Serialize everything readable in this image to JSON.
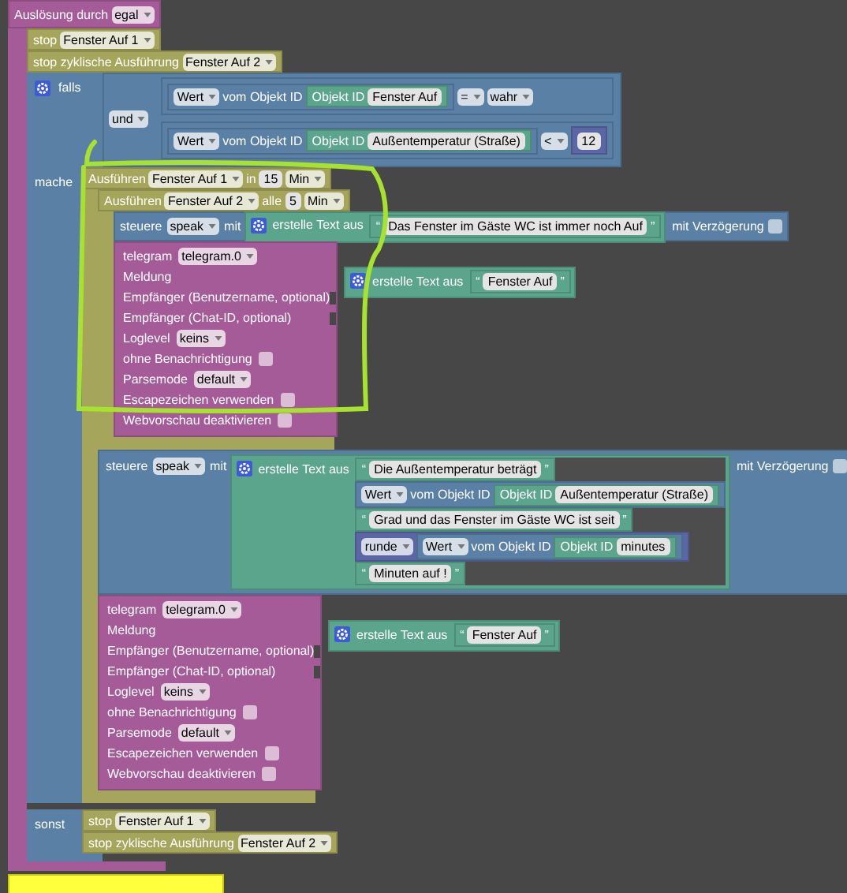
{
  "trigger": {
    "label": "Auslösung durch",
    "value": "egal"
  },
  "top_actions": [
    {
      "label": "stop",
      "value": "Fenster Auf 1"
    },
    {
      "label": "stop zyklische Ausführung",
      "value": "Fenster Auf 2"
    }
  ],
  "if_block": {
    "if_label": "falls",
    "do_label": "mache",
    "else_label": "sonst",
    "logic": "und",
    "conditions": [
      {
        "source": "Wert",
        "of": "vom Objekt ID",
        "id_label": "Objekt ID",
        "object": "Fenster Auf",
        "operator": "=",
        "kind": "bool",
        "value": "wahr"
      },
      {
        "source": "Wert",
        "of": "vom Objekt ID",
        "id_label": "Objekt ID",
        "object": "Außentemperatur (Straße)",
        "operator": "<",
        "kind": "number",
        "value": "12"
      }
    ]
  },
  "timer_1": {
    "label": "Ausführen",
    "value": "Fenster Auf 1",
    "in": "in",
    "amount": "15",
    "unit": "Min"
  },
  "timer_2": {
    "label": "Ausführen",
    "value": "Fenster Auf 2",
    "in": "alle",
    "amount": "5",
    "unit": "Min"
  },
  "speak_1": {
    "label": "steuere",
    "target": "speak",
    "with": "mit",
    "join": {
      "label": "erstelle Text aus",
      "parts": [
        {
          "kind": "text",
          "open": "“",
          "text": "Das Fenster im Gäste WC ist immer noch Auf",
          "close": "”"
        }
      ]
    },
    "delay_label": "mit Verzögerung",
    "delay": false
  },
  "telegram_1": {
    "label": "telegram",
    "instance": "telegram.0",
    "message_label": "Meldung",
    "message": {
      "label": "erstelle Text aus",
      "parts": [
        {
          "kind": "text",
          "open": "“",
          "text": "Fenster Auf",
          "close": "”"
        }
      ]
    },
    "rows": [
      {
        "kind": "input",
        "label": "Empfänger (Benutzername, optional)"
      },
      {
        "kind": "input",
        "label": "Empfänger (Chat-ID, optional)"
      },
      {
        "kind": "dropdown",
        "label": "Loglevel",
        "value": "keins"
      },
      {
        "kind": "checkbox",
        "label": "ohne Benachrichtigung",
        "checked": false
      },
      {
        "kind": "dropdown",
        "label": "Parsemode",
        "value": "default"
      },
      {
        "kind": "checkbox",
        "label": "Escapezeichen verwenden",
        "checked": false
      },
      {
        "kind": "checkbox",
        "label": "Webvorschau deaktivieren",
        "checked": false
      }
    ]
  },
  "speak_2": {
    "label": "steuere",
    "target": "speak",
    "with": "mit",
    "join": {
      "label": "erstelle Text aus",
      "parts": [
        {
          "kind": "text",
          "open": "“",
          "text": "Die Außentemperatur beträgt",
          "close": "”"
        },
        {
          "kind": "value",
          "source": "Wert",
          "of": "vom Objekt ID",
          "id_label": "Objekt ID",
          "object": "Außentemperatur (Straße)"
        },
        {
          "kind": "text",
          "open": "“",
          "text": "Grad und das Fenster im Gäste WC ist seit",
          "close": "”"
        },
        {
          "kind": "round",
          "op": "runde",
          "source": "Wert",
          "of": "vom Objekt ID",
          "id_label": "Objekt ID",
          "object": "minutes"
        },
        {
          "kind": "text",
          "open": "“",
          "text": "Minuten auf !",
          "close": "”"
        }
      ]
    },
    "delay_label": "mit Verzögerung",
    "delay": false
  },
  "telegram_2": {
    "label": "telegram",
    "instance": "telegram.0",
    "message_label": "Meldung",
    "message": {
      "label": "erstelle Text aus",
      "parts": [
        {
          "kind": "text",
          "open": "“",
          "text": "Fenster Auf",
          "close": "”"
        }
      ]
    },
    "rows": [
      {
        "kind": "input",
        "label": "Empfänger (Benutzername, optional)"
      },
      {
        "kind": "input",
        "label": "Empfänger (Chat-ID, optional)"
      },
      {
        "kind": "dropdown",
        "label": "Loglevel",
        "value": "keins"
      },
      {
        "kind": "checkbox",
        "label": "ohne Benachrichtigung",
        "checked": false
      },
      {
        "kind": "dropdown",
        "label": "Parsemode",
        "value": "default"
      },
      {
        "kind": "checkbox",
        "label": "Escapezeichen verwenden",
        "checked": false
      },
      {
        "kind": "checkbox",
        "label": "Webvorschau deaktivieren",
        "checked": false
      }
    ]
  },
  "else_actions": [
    {
      "label": "stop",
      "value": "Fenster Auf 1"
    },
    {
      "label": "stop zyklische Ausführung",
      "value": "Fenster Auf 2"
    }
  ]
}
